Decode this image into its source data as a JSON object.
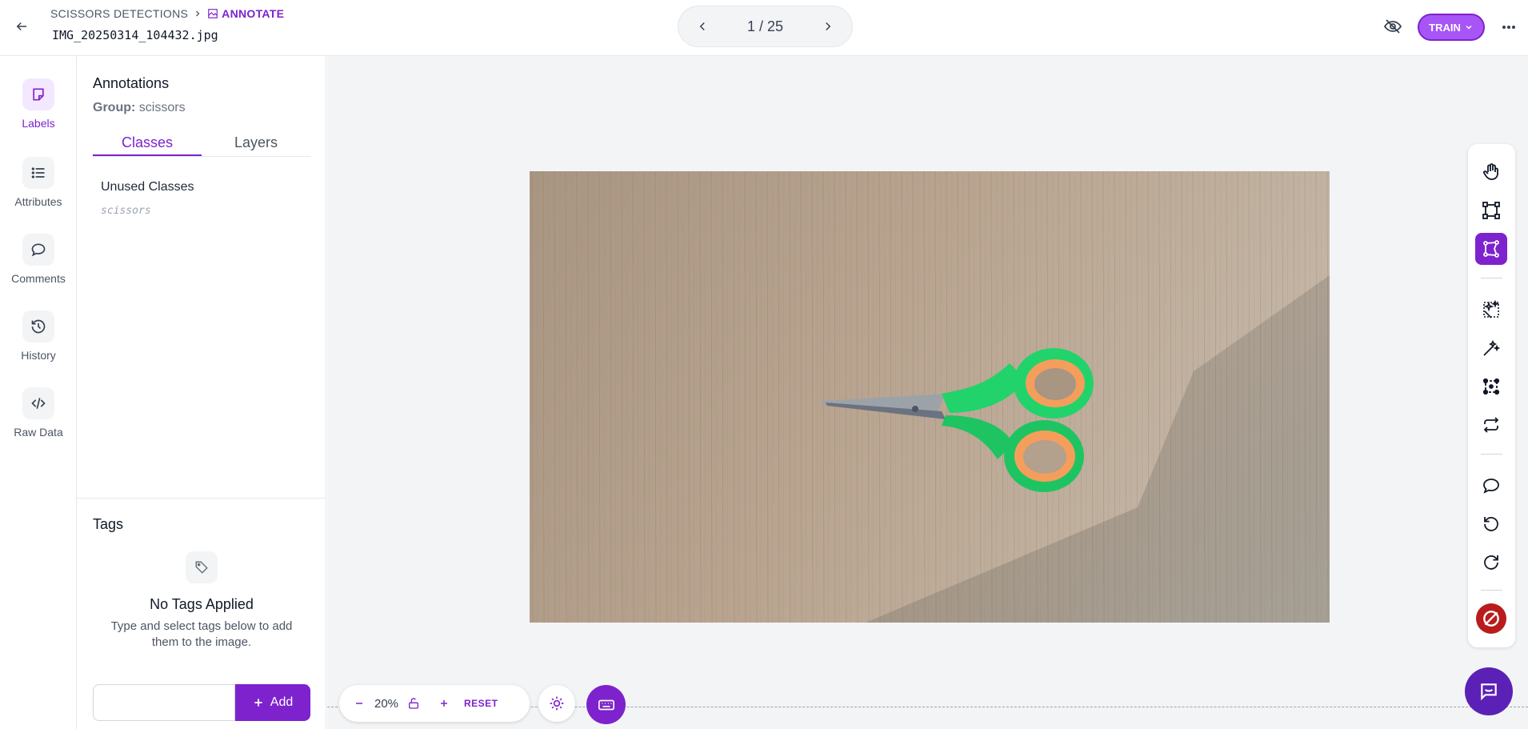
{
  "header": {
    "breadcrumb_project": "SCISSORS DETECTIONS",
    "breadcrumb_current": "ANNOTATE",
    "filename": "IMG_20250314_104432.jpg",
    "pager": "1 / 25",
    "train_label": "TRAIN"
  },
  "rail": {
    "items": [
      {
        "label": "Labels",
        "icon": "sticky-note-icon"
      },
      {
        "label": "Attributes",
        "icon": "list-icon"
      },
      {
        "label": "Comments",
        "icon": "comment-icon"
      },
      {
        "label": "History",
        "icon": "history-icon"
      },
      {
        "label": "Raw Data",
        "icon": "code-icon"
      }
    ]
  },
  "panel": {
    "title": "Annotations",
    "group_label": "Group:",
    "group_value": "scissors",
    "tabs": [
      {
        "label": "Classes",
        "active": true
      },
      {
        "label": "Layers",
        "active": false
      }
    ],
    "unused_title": "Unused Classes",
    "unused_items": [
      "scissors"
    ]
  },
  "tags": {
    "title": "Tags",
    "empty_title": "No Tags Applied",
    "empty_desc": "Type and select tags below to add them to the image.",
    "input_placeholder": "",
    "add_label": "Add"
  },
  "zoom": {
    "value": "20%",
    "reset_label": "RESET"
  },
  "colors": {
    "accent": "#7e22ce",
    "train_bg": "#a855f7",
    "danger": "#b91c1c"
  }
}
